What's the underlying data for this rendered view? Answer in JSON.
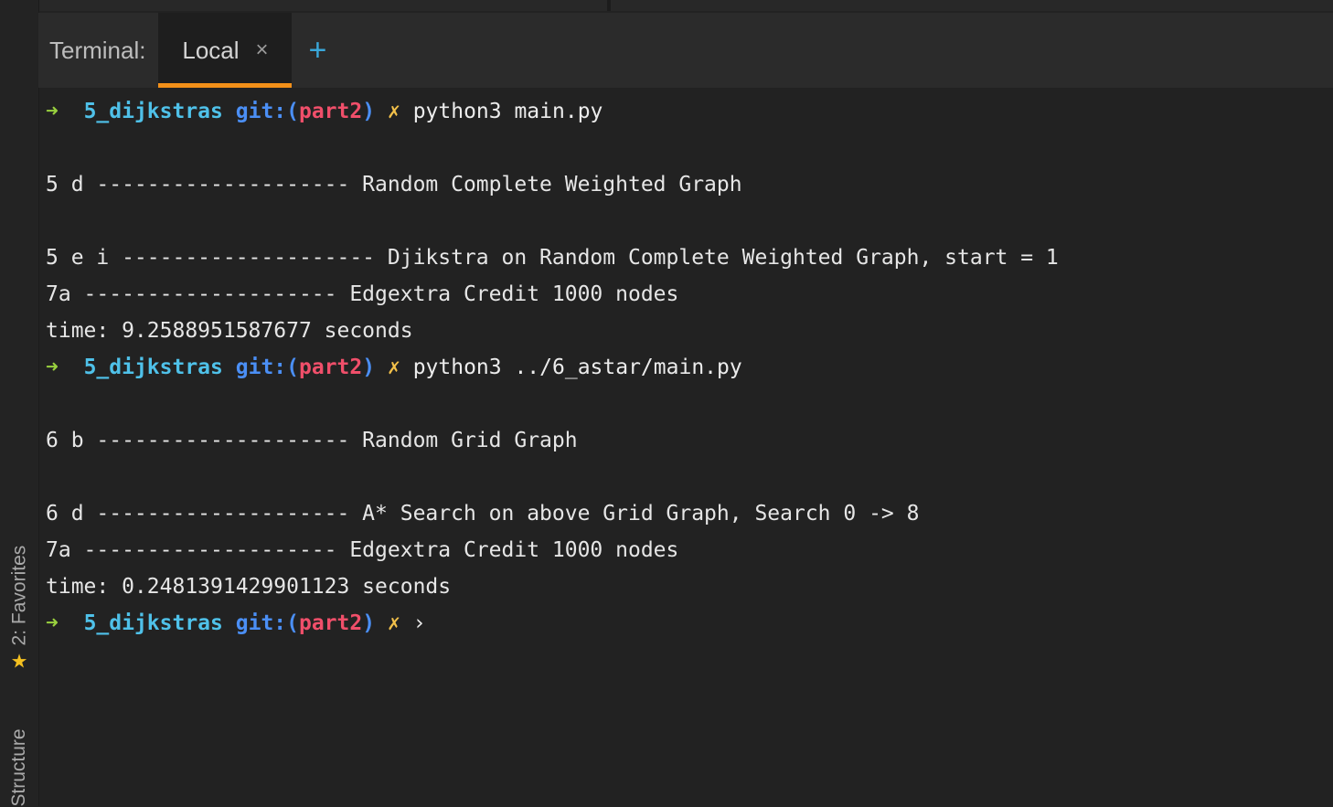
{
  "sidebar": {
    "favorites_label": "2: Favorites",
    "structure_label": "Structure"
  },
  "tabbar": {
    "title": "Terminal:",
    "active_tab": "Local",
    "close_glyph": "×",
    "new_tab_glyph": "+"
  },
  "prompt": {
    "arrow": "➜",
    "dir": "5_dijkstras",
    "git_prefix": "git:(",
    "branch": "part2",
    "git_suffix": ")",
    "dirty": "✗"
  },
  "output": {
    "cmd1": "python3 main.py",
    "l1": "5 d -------------------- Random Complete Weighted Graph",
    "l2": "5 e i -------------------- Djikstra on Random Complete Weighted Graph, start = 1",
    "l3": "7a -------------------- Edgextra Credit 1000 nodes",
    "l4": "time: 9.2588951587677 seconds",
    "cmd2": "python3 ../6_astar/main.py",
    "l5": "6 b -------------------- Random Grid Graph",
    "l6": "6 d -------------------- A* Search on above Grid Graph, Search 0 -> 8",
    "l7": "7a -------------------- Edgextra Credit 1000 nodes",
    "l8": "time: 0.2481391429901123 seconds",
    "cursor": "›"
  },
  "colors": {
    "arrow": "#99d13e",
    "dir": "#4fc1e9",
    "git": "#4b8ff5",
    "branch": "#f04f6a",
    "dirty": "#f3c14a",
    "tab_underline": "#f39019"
  }
}
